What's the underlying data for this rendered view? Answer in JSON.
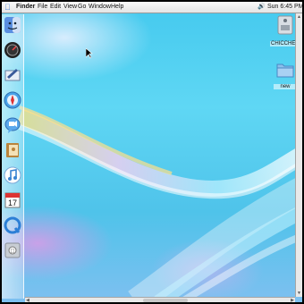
{
  "menubar": {
    "items": [
      "Finder",
      "File",
      "Edit",
      "View",
      "Go",
      "Window",
      "Help"
    ],
    "clock": "Sun 6:45 PM"
  },
  "desktop": {
    "icons": [
      {
        "label": "CHICCHE FASI",
        "icon": "hard-drive-icon"
      },
      {
        "label": "new",
        "icon": "folder-icon"
      }
    ]
  },
  "dock": {
    "items": [
      "finder-icon",
      "dashboard-icon",
      "mail-icon",
      "safari-icon",
      "ichat-icon",
      "address-book-icon",
      "itunes-icon",
      "ical-icon",
      "quicktime-icon",
      "system-preferences-icon"
    ],
    "ical_day": "17"
  },
  "colors": {
    "menubar": "#f0f0f0",
    "wallpaper": "#4fc8ee",
    "accent": "#3a7ad8"
  }
}
